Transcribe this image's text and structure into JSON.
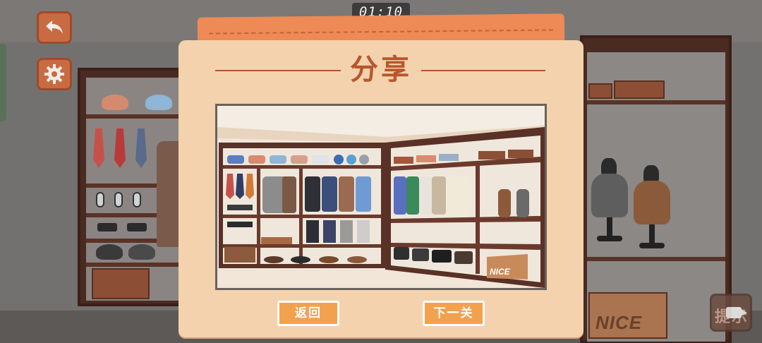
{
  "timer": "01:10",
  "dialog": {
    "title": "分享",
    "back_label": "返回",
    "next_label": "下一关"
  },
  "hint": {
    "label": "提示"
  },
  "icons": {
    "back": "back-arrow-icon",
    "settings": "gear-icon",
    "hint_video": "video-icon"
  },
  "preview": {
    "box_brand": "NICE"
  },
  "scene": {
    "box_brand": "NICE"
  },
  "colors": {
    "accent": "#ed8a55",
    "button": "#f2a24e",
    "panel": "#f4d2ad",
    "title": "#b9552c",
    "wood": "#4a2b22"
  }
}
